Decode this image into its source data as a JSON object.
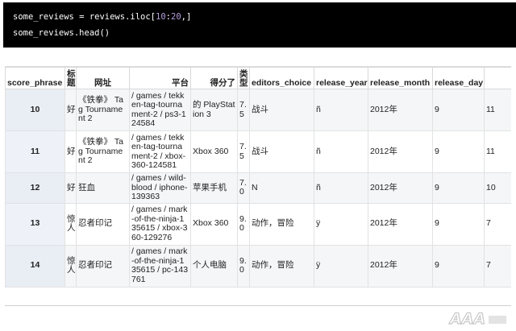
{
  "code": {
    "line1_prefix": "some_reviews = reviews.iloc[",
    "line1_num1": "10",
    "line1_colon": ":",
    "line1_num2": "20",
    "line1_suffix": ",]",
    "line2": "some_reviews.head()"
  },
  "table": {
    "headers": [
      "score_phrase",
      "标题",
      "网址",
      "平台",
      "得分了",
      "类型",
      "editors_choice",
      "release_year",
      "release_month",
      "release_day"
    ],
    "rows": [
      [
        "10",
        "好",
        "《铁拳》 Tag Tournament 2",
        "/ games / tekken-tag-tournament-2 / ps3-124584",
        "的 PlayStation 3",
        "7.5",
        "战斗",
        "ñ",
        "2012年",
        "9",
        "11"
      ],
      [
        "11",
        "好",
        "《铁拳》 Tag Tournament 2",
        "/ games / tekken-tag-tournament-2 / xbox-360-124581",
        "Xbox 360",
        "7.5",
        "战斗",
        "ñ",
        "2012年",
        "9",
        "11"
      ],
      [
        "12",
        "好",
        "狂血",
        "/ games / wild-blood / iphone-139363",
        "苹果手机",
        "7.0",
        "N",
        "ñ",
        "2012年",
        "9",
        "10"
      ],
      [
        "13",
        "惊人",
        "忍者印记",
        "/ games / mark-of-the-ninja-135615 / xbox-360-129276",
        "Xbox 360",
        "9.0",
        "动作，冒险",
        "ÿ",
        "2012年",
        "9",
        "7"
      ],
      [
        "14",
        "惊人",
        "忍者印记",
        "/ games / mark-of-the-ninja-135615 / pc-143761",
        "个人电脑",
        "9.0",
        "动作，冒险",
        "ÿ",
        "2012年",
        "9",
        "7"
      ]
    ]
  },
  "watermark": {
    "logo_text": "AAA"
  }
}
